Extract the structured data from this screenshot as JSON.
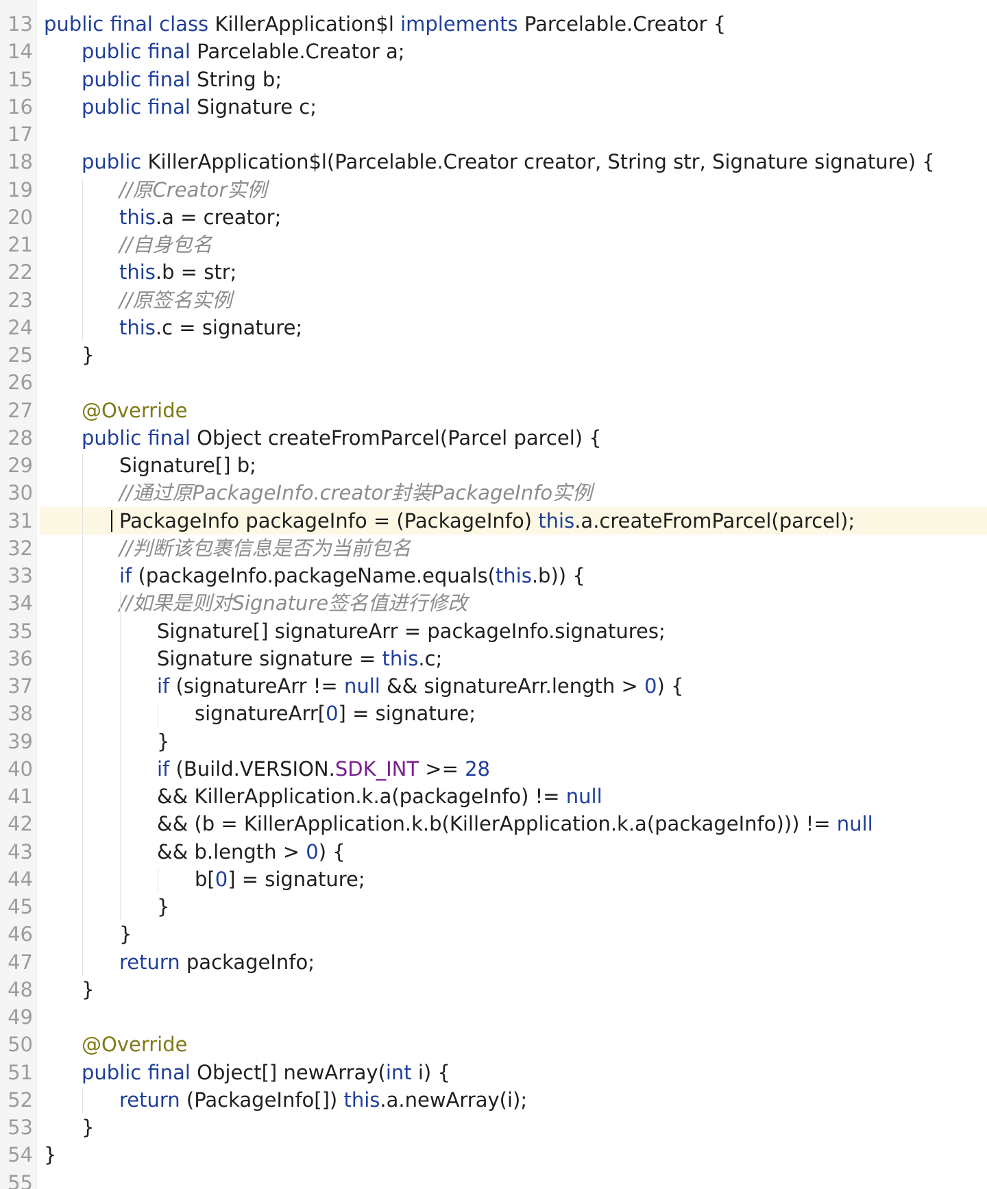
{
  "editor": {
    "current_line": "31",
    "colors": {
      "keyword": "#1f3f9a",
      "number": "#1f3f9a",
      "annotation": "#7f7a16",
      "field": "#7a1f8f",
      "comment": "#8c8c8c",
      "text": "#1f1f1f",
      "current_line_bg": "#fdf8e4",
      "gutter_text": "#9c9c9c"
    },
    "lines": [
      {
        "n": "13",
        "indent": 0,
        "tokens": [
          [
            "kw",
            "public final class "
          ],
          [
            "t",
            "KillerApplication$l "
          ],
          [
            "kw",
            "implements "
          ],
          [
            "t",
            "Parcelable.Creator {"
          ]
        ]
      },
      {
        "n": "14",
        "indent": 1,
        "tokens": [
          [
            "kw",
            "public final "
          ],
          [
            "t",
            "Parcelable.Creator a;"
          ]
        ]
      },
      {
        "n": "15",
        "indent": 1,
        "tokens": [
          [
            "kw",
            "public final "
          ],
          [
            "t",
            "String b;"
          ]
        ]
      },
      {
        "n": "16",
        "indent": 1,
        "tokens": [
          [
            "kw",
            "public final "
          ],
          [
            "t",
            "Signature c;"
          ]
        ]
      },
      {
        "n": "17",
        "indent": 0,
        "tokens": []
      },
      {
        "n": "18",
        "indent": 1,
        "tokens": [
          [
            "kw",
            "public "
          ],
          [
            "t",
            "KillerApplication$l(Parcelable.Creator creator, String str, Signature signature) {"
          ]
        ]
      },
      {
        "n": "19",
        "indent": 2,
        "tokens": [
          [
            "c",
            "//原Creator实例"
          ]
        ]
      },
      {
        "n": "20",
        "indent": 2,
        "tokens": [
          [
            "kw",
            "this"
          ],
          [
            "t",
            ".a = creator;"
          ]
        ]
      },
      {
        "n": "21",
        "indent": 2,
        "tokens": [
          [
            "c",
            "//自身包名"
          ]
        ]
      },
      {
        "n": "22",
        "indent": 2,
        "tokens": [
          [
            "kw",
            "this"
          ],
          [
            "t",
            ".b = str;"
          ]
        ]
      },
      {
        "n": "23",
        "indent": 2,
        "tokens": [
          [
            "c",
            "//原签名实例"
          ]
        ]
      },
      {
        "n": "24",
        "indent": 2,
        "tokens": [
          [
            "kw",
            "this"
          ],
          [
            "t",
            ".c = signature;"
          ]
        ]
      },
      {
        "n": "25",
        "indent": 1,
        "tokens": [
          [
            "t",
            "}"
          ]
        ]
      },
      {
        "n": "26",
        "indent": 0,
        "tokens": []
      },
      {
        "n": "27",
        "indent": 1,
        "tokens": [
          [
            "a",
            "@Override"
          ]
        ]
      },
      {
        "n": "28",
        "indent": 1,
        "tokens": [
          [
            "kw",
            "public final "
          ],
          [
            "t",
            "Object createFromParcel(Parcel parcel) {"
          ]
        ]
      },
      {
        "n": "29",
        "indent": 2,
        "tokens": [
          [
            "t",
            "Signature[] b;"
          ]
        ]
      },
      {
        "n": "30",
        "indent": 2,
        "tokens": [
          [
            "c",
            "//通过原PackageInfo.creator封装PackageInfo实例"
          ]
        ]
      },
      {
        "n": "31",
        "indent": 2,
        "tokens": [
          [
            "t",
            "PackageInfo packageInfo = (PackageInfo) "
          ],
          [
            "kw",
            "this"
          ],
          [
            "t",
            ".a.createFromParcel(parcel);"
          ]
        ]
      },
      {
        "n": "32",
        "indent": 2,
        "tokens": [
          [
            "c",
            "//判断该包裹信息是否为当前包名"
          ]
        ]
      },
      {
        "n": "33",
        "indent": 2,
        "tokens": [
          [
            "kw",
            "if "
          ],
          [
            "t",
            "(packageInfo.packageName.equals("
          ],
          [
            "kw",
            "this"
          ],
          [
            "t",
            ".b)) {"
          ]
        ]
      },
      {
        "n": "34",
        "indent": 2,
        "tokens": [
          [
            "c",
            "//如果是则对Signature签名值进行修改"
          ]
        ]
      },
      {
        "n": "35",
        "indent": 3,
        "tokens": [
          [
            "t",
            "Signature[] signatureArr = packageInfo.signatures;"
          ]
        ]
      },
      {
        "n": "36",
        "indent": 3,
        "tokens": [
          [
            "t",
            "Signature signature = "
          ],
          [
            "kw",
            "this"
          ],
          [
            "t",
            ".c;"
          ]
        ]
      },
      {
        "n": "37",
        "indent": 3,
        "tokens": [
          [
            "kw",
            "if "
          ],
          [
            "t",
            "(signatureArr != "
          ],
          [
            "kw",
            "null "
          ],
          [
            "t",
            "&& signatureArr.length > "
          ],
          [
            "n",
            "0"
          ],
          [
            "t",
            ") {"
          ]
        ]
      },
      {
        "n": "38",
        "indent": 4,
        "tokens": [
          [
            "t",
            "signatureArr["
          ],
          [
            "n",
            "0"
          ],
          [
            "t",
            "] = signature;"
          ]
        ]
      },
      {
        "n": "39",
        "indent": 3,
        "tokens": [
          [
            "t",
            "}"
          ]
        ]
      },
      {
        "n": "40",
        "indent": 3,
        "tokens": [
          [
            "kw",
            "if "
          ],
          [
            "t",
            "(Build.VERSION."
          ],
          [
            "f",
            "SDK_INT"
          ],
          [
            "t",
            " >= "
          ],
          [
            "n",
            "28"
          ]
        ]
      },
      {
        "n": "41",
        "indent": 3,
        "tokens": [
          [
            "t",
            "&& KillerApplication.k.a(packageInfo) != "
          ],
          [
            "kw",
            "null"
          ]
        ]
      },
      {
        "n": "42",
        "indent": 3,
        "tokens": [
          [
            "t",
            "&& (b = KillerApplication.k.b(KillerApplication.k.a(packageInfo))) != "
          ],
          [
            "kw",
            "null"
          ]
        ]
      },
      {
        "n": "43",
        "indent": 3,
        "tokens": [
          [
            "t",
            "&& b.length > "
          ],
          [
            "n",
            "0"
          ],
          [
            "t",
            ") {"
          ]
        ]
      },
      {
        "n": "44",
        "indent": 4,
        "tokens": [
          [
            "t",
            "b["
          ],
          [
            "n",
            "0"
          ],
          [
            "t",
            "] = signature;"
          ]
        ]
      },
      {
        "n": "45",
        "indent": 3,
        "tokens": [
          [
            "t",
            "}"
          ]
        ]
      },
      {
        "n": "46",
        "indent": 2,
        "tokens": [
          [
            "t",
            "}"
          ]
        ]
      },
      {
        "n": "47",
        "indent": 2,
        "tokens": [
          [
            "kw",
            "return "
          ],
          [
            "t",
            "packageInfo;"
          ]
        ]
      },
      {
        "n": "48",
        "indent": 1,
        "tokens": [
          [
            "t",
            "}"
          ]
        ]
      },
      {
        "n": "49",
        "indent": 0,
        "tokens": []
      },
      {
        "n": "50",
        "indent": 1,
        "tokens": [
          [
            "a",
            "@Override"
          ]
        ]
      },
      {
        "n": "51",
        "indent": 1,
        "tokens": [
          [
            "kw",
            "public final "
          ],
          [
            "t",
            "Object[] newArray("
          ],
          [
            "kw",
            "int "
          ],
          [
            "t",
            "i) {"
          ]
        ]
      },
      {
        "n": "52",
        "indent": 2,
        "tokens": [
          [
            "kw",
            "return "
          ],
          [
            "t",
            "(PackageInfo[]) "
          ],
          [
            "kw",
            "this"
          ],
          [
            "t",
            ".a.newArray(i);"
          ]
        ]
      },
      {
        "n": "53",
        "indent": 1,
        "tokens": [
          [
            "t",
            "}"
          ]
        ]
      },
      {
        "n": "54",
        "indent": 0,
        "tokens": [
          [
            "t",
            "}"
          ]
        ]
      },
      {
        "n": "55",
        "indent": 0,
        "tokens": []
      }
    ]
  }
}
